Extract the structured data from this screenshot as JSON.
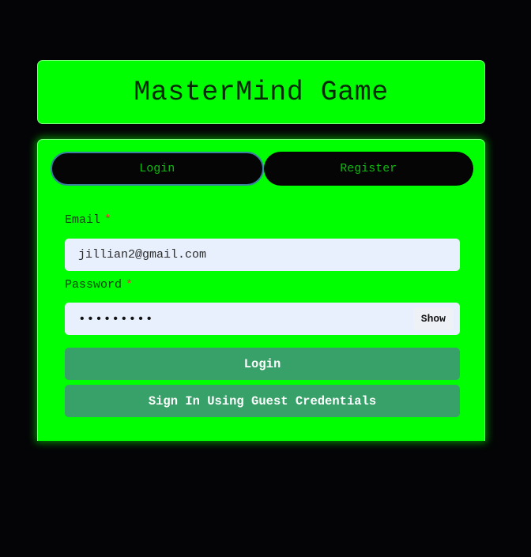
{
  "header": {
    "title": "MasterMind Game"
  },
  "tabs": [
    {
      "label": "Login",
      "active": true
    },
    {
      "label": "Register",
      "active": false
    }
  ],
  "form": {
    "email": {
      "label": "Email",
      "required_mark": "*",
      "value": "jillian2@gmail.com"
    },
    "password": {
      "label": "Password",
      "required_mark": "*",
      "masked_value": "•••••••••",
      "toggle_label": "Show"
    },
    "login_button": "Login",
    "guest_button": "Sign In Using Guest Credentials"
  },
  "colors": {
    "page_background": "#040406",
    "panel_green": "#00ff00",
    "tab_background": "#050505",
    "tab_text": "#0fb80f",
    "button_green": "#38a169",
    "input_background": "#e8f0fe",
    "required_red": "#e53030"
  }
}
